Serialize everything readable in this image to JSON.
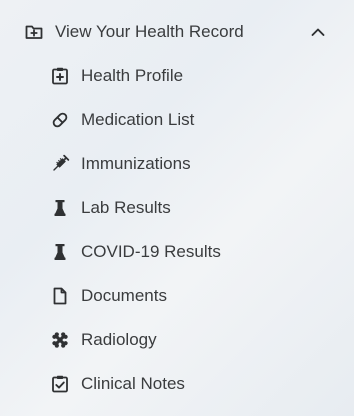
{
  "section": {
    "title": "View Your Health Record",
    "icon": "folder-plus-icon",
    "toggle_icon": "chevron-up-icon",
    "expanded": true
  },
  "items": [
    {
      "label": "Health Profile",
      "icon": "medical-profile-icon"
    },
    {
      "label": "Medication List",
      "icon": "pill-icon"
    },
    {
      "label": "Immunizations",
      "icon": "syringe-icon"
    },
    {
      "label": "Lab Results",
      "icon": "lab-flask-icon"
    },
    {
      "label": "COVID-19 Results",
      "icon": "lab-flask-icon"
    },
    {
      "label": "Documents",
      "icon": "document-icon"
    },
    {
      "label": "Radiology",
      "icon": "x-ray-icon"
    },
    {
      "label": "Clinical Notes",
      "icon": "clipboard-check-icon"
    }
  ],
  "colors": {
    "text": "#3a3c3e",
    "icon": "#2f3133"
  }
}
